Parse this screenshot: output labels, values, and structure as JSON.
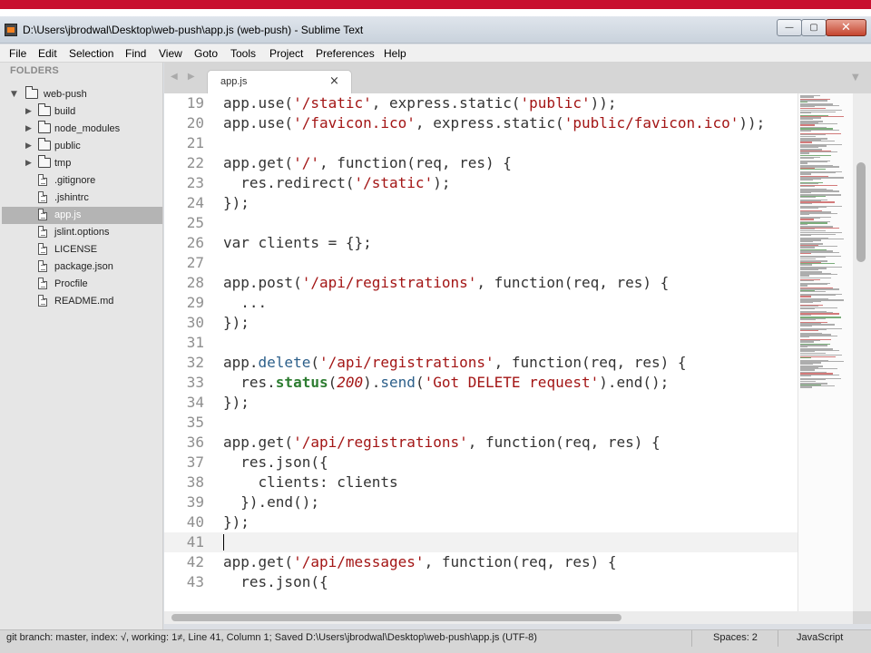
{
  "window": {
    "title": "D:\\Users\\jbrodwal\\Desktop\\web-push\\app.js (web-push) - Sublime Text",
    "controls": {
      "minimize": "—",
      "maximize": "▢",
      "close": "✕"
    }
  },
  "menu": [
    "File",
    "Edit",
    "Selection",
    "Find",
    "View",
    "Goto",
    "Tools",
    "Project",
    "Preferences",
    "Help"
  ],
  "sidebar": {
    "header": "FOLDERS",
    "root": "web-push",
    "items": [
      {
        "label": "build",
        "type": "folder"
      },
      {
        "label": "node_modules",
        "type": "folder"
      },
      {
        "label": "public",
        "type": "folder"
      },
      {
        "label": "tmp",
        "type": "folder"
      },
      {
        "label": ".gitignore",
        "type": "file"
      },
      {
        "label": ".jshintrc",
        "type": "file"
      },
      {
        "label": "app.js",
        "type": "file",
        "selected": true
      },
      {
        "label": "jslint.options",
        "type": "file"
      },
      {
        "label": "LICENSE",
        "type": "file"
      },
      {
        "label": "package.json",
        "type": "file"
      },
      {
        "label": "Procfile",
        "type": "file"
      },
      {
        "label": "README.md",
        "type": "file"
      }
    ]
  },
  "tabs": {
    "nav_arrows": "◀ ▶",
    "overflow": "▼",
    "active": {
      "label": "app.js",
      "close": "×"
    }
  },
  "editor": {
    "current_line": 41,
    "lines": [
      {
        "n": "19",
        "tokens": [
          [
            "app.use(",
            ""
          ],
          [
            "'/static'",
            "str"
          ],
          [
            ", express.static(",
            ""
          ],
          [
            "'public'",
            "str"
          ],
          [
            "));",
            ""
          ]
        ]
      },
      {
        "n": "20",
        "tokens": [
          [
            "app.use(",
            ""
          ],
          [
            "'/favicon.ico'",
            "str"
          ],
          [
            ", express.static(",
            ""
          ],
          [
            "'public/favicon.ico'",
            "str"
          ],
          [
            "));",
            ""
          ]
        ]
      },
      {
        "n": "21",
        "tokens": []
      },
      {
        "n": "22",
        "tokens": [
          [
            "app.get(",
            ""
          ],
          [
            "'/'",
            "str"
          ],
          [
            ", function(req, res) {",
            ""
          ]
        ]
      },
      {
        "n": "23",
        "tokens": [
          [
            "  res.redirect(",
            ""
          ],
          [
            "'/static'",
            "str"
          ],
          [
            ");",
            ""
          ]
        ]
      },
      {
        "n": "24",
        "tokens": [
          [
            "});",
            ""
          ]
        ]
      },
      {
        "n": "25",
        "tokens": []
      },
      {
        "n": "26",
        "tokens": [
          [
            "var clients = {};",
            ""
          ]
        ]
      },
      {
        "n": "27",
        "tokens": []
      },
      {
        "n": "28",
        "tokens": [
          [
            "app.post(",
            ""
          ],
          [
            "'/api/registrations'",
            "str"
          ],
          [
            ", function(req, res) {",
            ""
          ]
        ]
      },
      {
        "n": "29",
        "tokens": [
          [
            "  ...",
            ""
          ]
        ]
      },
      {
        "n": "30",
        "tokens": [
          [
            "});",
            ""
          ]
        ]
      },
      {
        "n": "31",
        "tokens": []
      },
      {
        "n": "32",
        "tokens": [
          [
            "app.",
            ""
          ],
          [
            "delete",
            "kw"
          ],
          [
            "(",
            ""
          ],
          [
            "'/api/registrations'",
            "str"
          ],
          [
            ", function(req, res) {",
            ""
          ]
        ]
      },
      {
        "n": "33",
        "tokens": [
          [
            "  res.",
            ""
          ],
          [
            "status",
            "green"
          ],
          [
            "(",
            ""
          ],
          [
            "200",
            "num"
          ],
          [
            ").",
            ""
          ],
          [
            "send",
            "kw"
          ],
          [
            "(",
            ""
          ],
          [
            "'Got DELETE request'",
            "str"
          ],
          [
            ").end();",
            ""
          ]
        ]
      },
      {
        "n": "34",
        "tokens": [
          [
            "});",
            ""
          ]
        ]
      },
      {
        "n": "35",
        "tokens": []
      },
      {
        "n": "36",
        "tokens": [
          [
            "app.get(",
            ""
          ],
          [
            "'/api/registrations'",
            "str"
          ],
          [
            ", function(req, res) {",
            ""
          ]
        ]
      },
      {
        "n": "37",
        "tokens": [
          [
            "  res.json({",
            ""
          ]
        ]
      },
      {
        "n": "38",
        "tokens": [
          [
            "    clients: clients",
            ""
          ]
        ]
      },
      {
        "n": "39",
        "tokens": [
          [
            "  }).end();",
            ""
          ]
        ]
      },
      {
        "n": "40",
        "tokens": [
          [
            "});",
            ""
          ]
        ]
      },
      {
        "n": "41",
        "tokens": []
      },
      {
        "n": "42",
        "tokens": [
          [
            "app.get(",
            ""
          ],
          [
            "'/api/messages'",
            "str"
          ],
          [
            ", function(req, res) {",
            ""
          ]
        ]
      },
      {
        "n": "43",
        "tokens": [
          [
            "  res.json({",
            ""
          ]
        ]
      }
    ]
  },
  "status": {
    "left": "git branch: master, index: √, working: 1≠, Line 41, Column 1; Saved D:\\Users\\jbrodwal\\Desktop\\web-push\\app.js (UTF-8)",
    "spaces": "Spaces: 2",
    "syntax": "JavaScript"
  },
  "colors": {
    "accent_band": "#c8102e",
    "string": "#a31515",
    "keyword": "#2c5f8a",
    "method_green": "#2e7d32"
  }
}
